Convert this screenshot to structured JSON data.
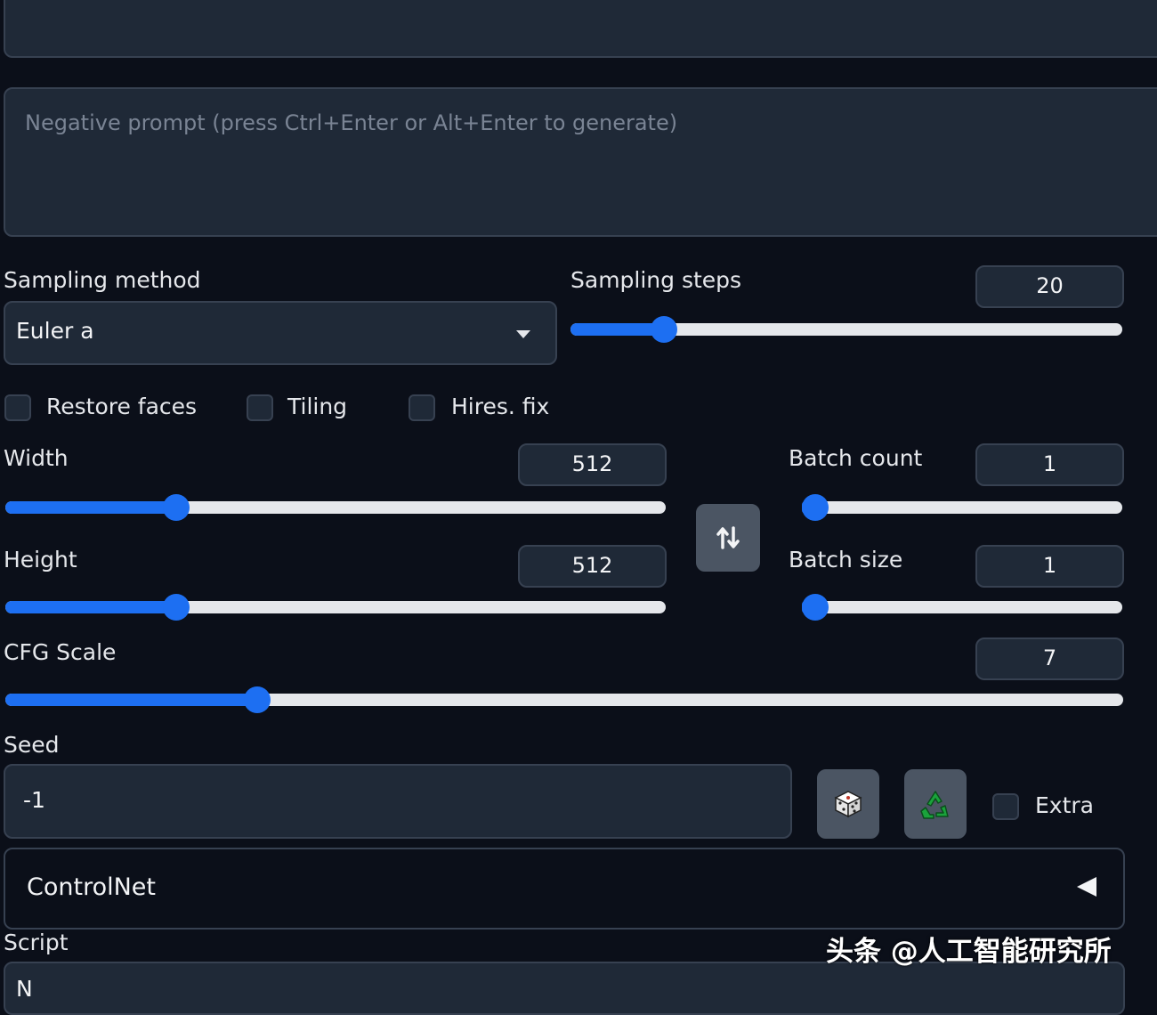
{
  "negative_prompt": {
    "placeholder": "Negative prompt (press Ctrl+Enter or Alt+Enter to generate)"
  },
  "sampling_method": {
    "label": "Sampling method",
    "value": "Euler a"
  },
  "sampling_steps": {
    "label": "Sampling steps",
    "value": "20",
    "fraction": 0.145
  },
  "checkboxes": [
    {
      "label": "Restore faces",
      "checked": false
    },
    {
      "label": "Tiling",
      "checked": false
    },
    {
      "label": "Hires. fix",
      "checked": false
    }
  ],
  "width": {
    "label": "Width",
    "value": "512",
    "fraction": 0.238
  },
  "height": {
    "label": "Height",
    "value": "512",
    "fraction": 0.238
  },
  "batch_count": {
    "label": "Batch count",
    "value": "1",
    "fraction": 0.0
  },
  "batch_size": {
    "label": "Batch size",
    "value": "1",
    "fraction": 0.0
  },
  "cfg_scale": {
    "label": "CFG Scale",
    "value": "7",
    "fraction": 0.213
  },
  "seed": {
    "label": "Seed",
    "value": "-1",
    "extra_label": "Extra"
  },
  "controlnet": {
    "title": "ControlNet"
  },
  "script": {
    "label": "Script",
    "value_partial": "N"
  },
  "watermark": {
    "text": "头条 @人工智能研究所"
  },
  "icons": {
    "swap": "swap-dimensions-icon",
    "dice": "random-seed-dice-icon",
    "recycle": "reuse-seed-recycle-icon",
    "dropdown": "chevron-down-icon",
    "collapse": "collapse-triangle-icon"
  },
  "colors": {
    "accent": "#1d6ff2",
    "panel": "#1f2937",
    "background": "#0b0f19"
  }
}
